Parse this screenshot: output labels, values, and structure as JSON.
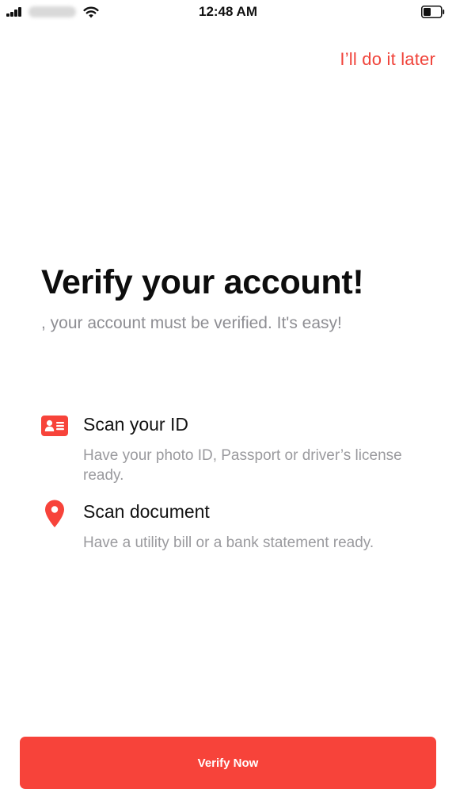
{
  "status_bar": {
    "time": "12:48 AM"
  },
  "header": {
    "skip_label": "I’ll do it later"
  },
  "main": {
    "title": "Verify your account!",
    "subtitle": ",  your account must be verified. It's easy!",
    "steps": [
      {
        "icon": "id-card-icon",
        "title": "Scan your ID",
        "description": "Have your photo ID, Passport or driver’s license ready."
      },
      {
        "icon": "location-pin-icon",
        "title": "Scan document",
        "description": "Have a utility bill or a bank statement ready."
      }
    ]
  },
  "footer": {
    "verify_label": "Verify Now"
  },
  "colors": {
    "accent": "#f7433a",
    "skip_text": "#f0433a",
    "muted_text": "#9a9a9e"
  }
}
